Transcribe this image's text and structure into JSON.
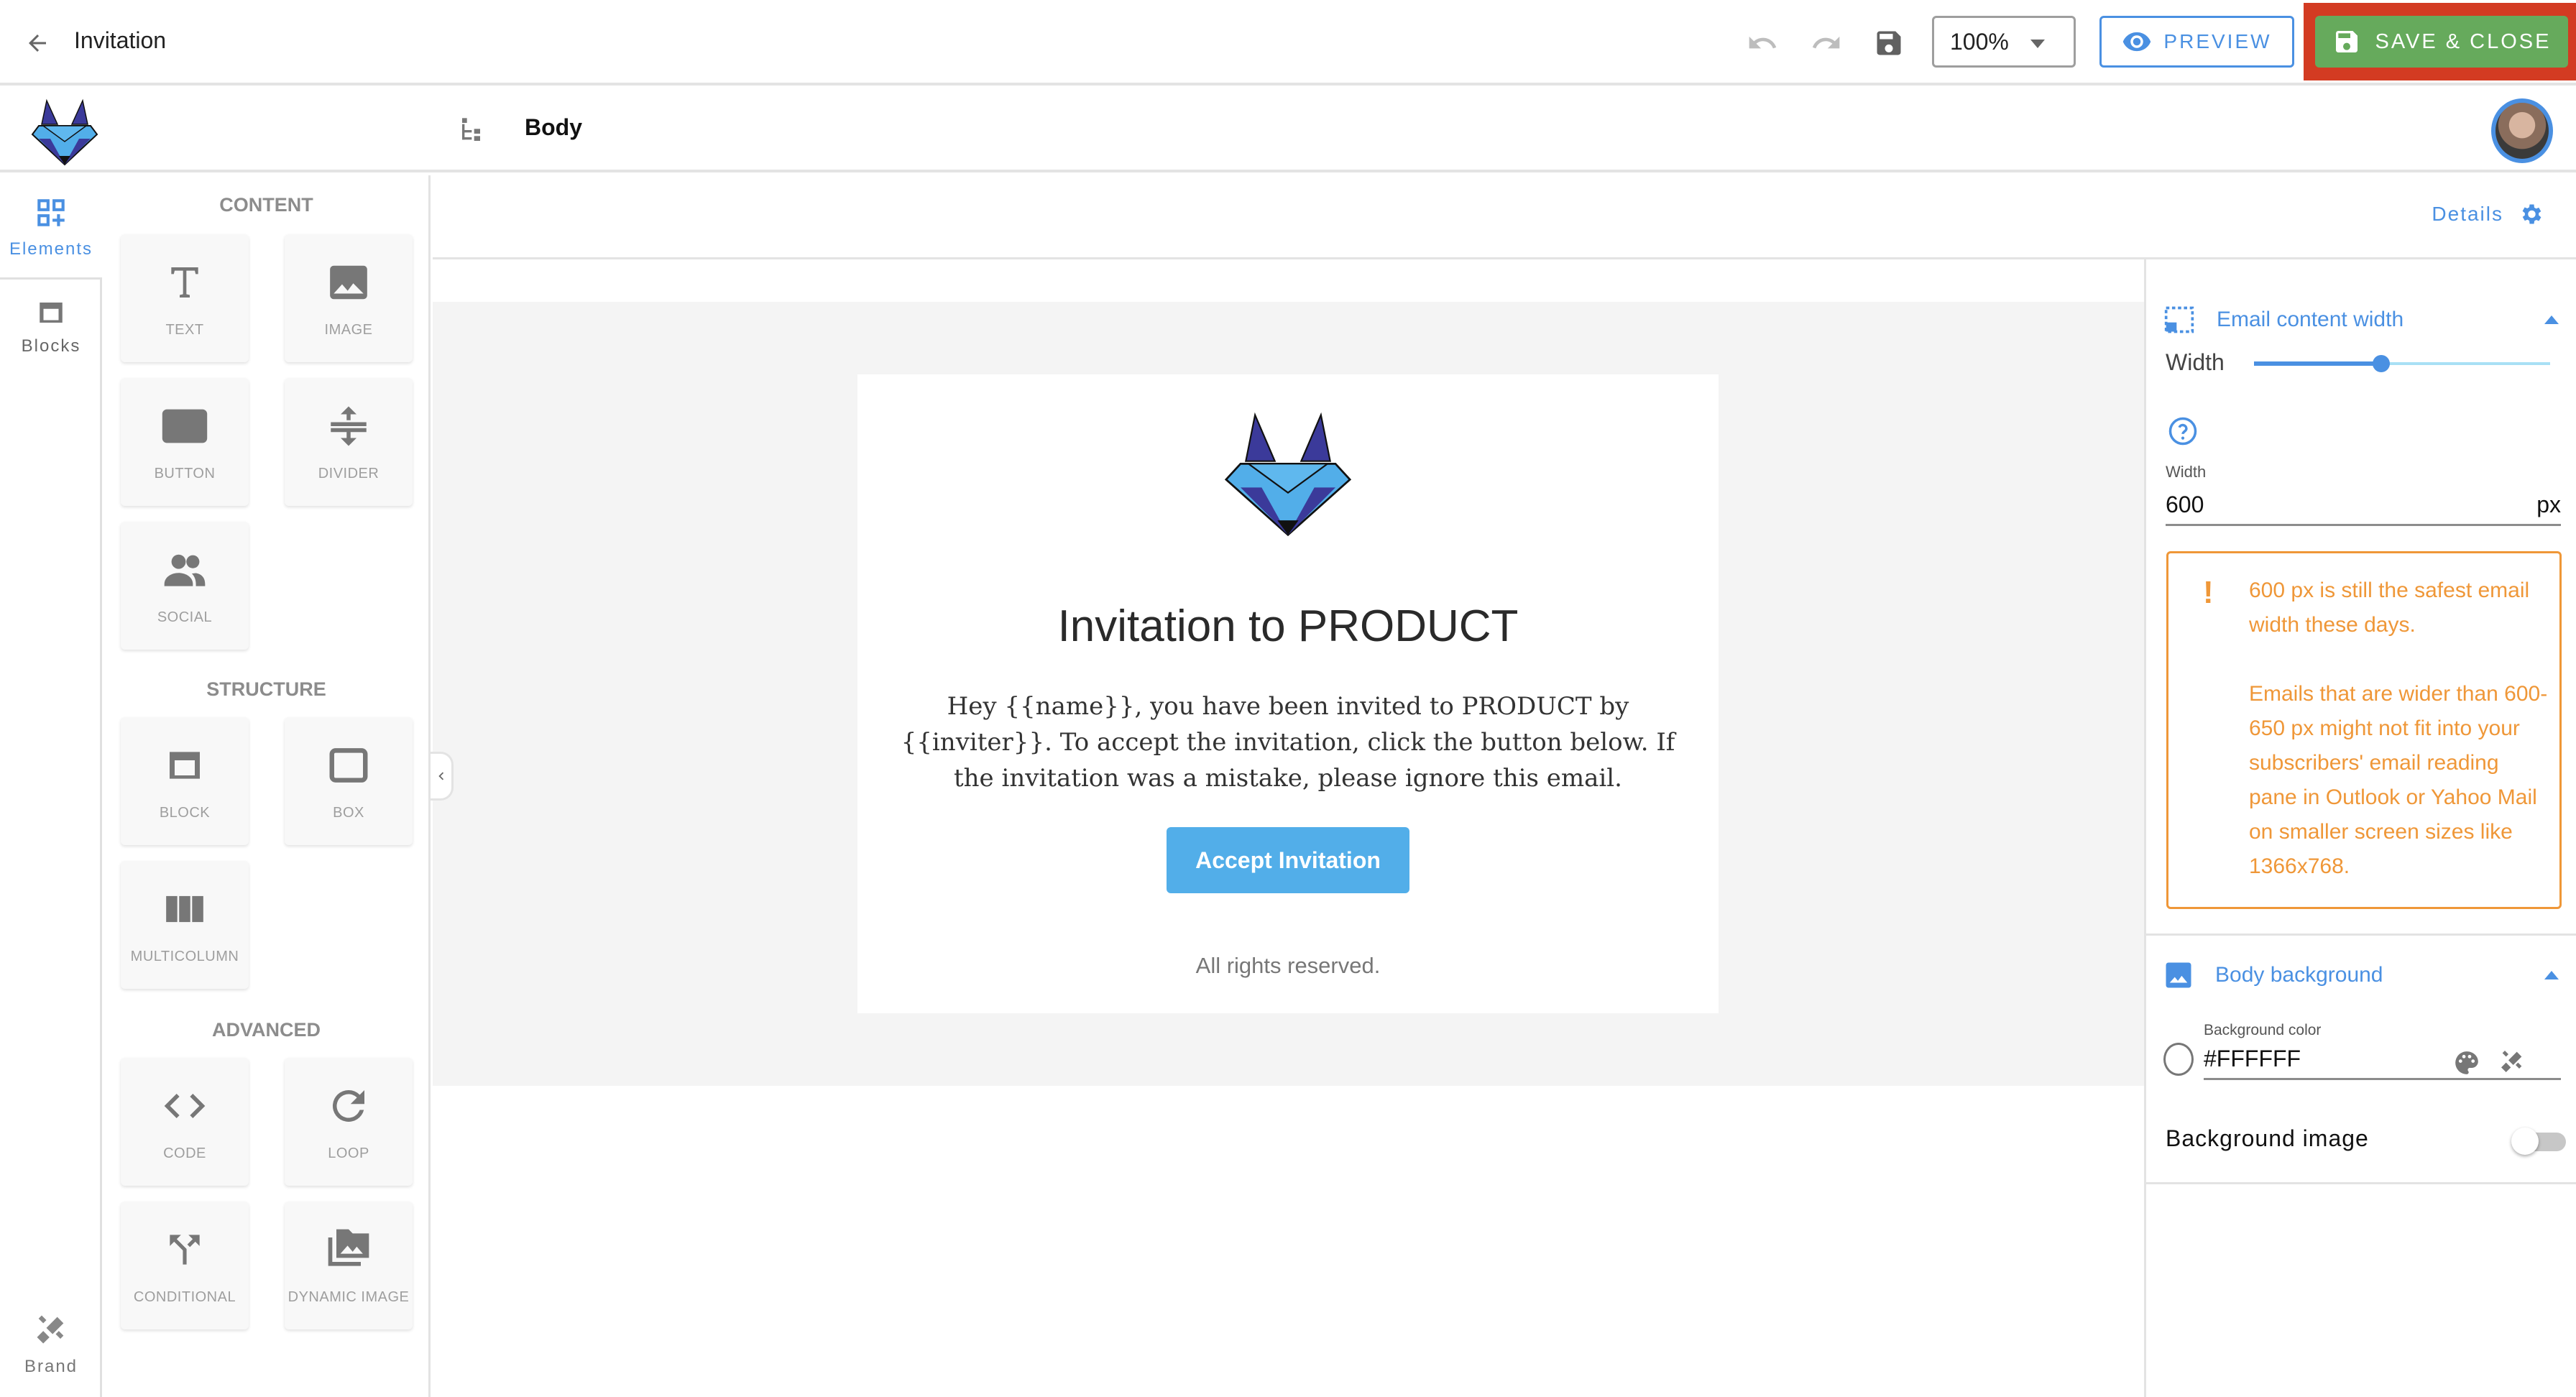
{
  "topbar": {
    "title": "Invitation",
    "zoom_value": "100%",
    "preview_label": "PREVIEW",
    "save_close_label": "SAVE & CLOSE",
    "icons": {
      "back": "arrow-left-icon",
      "undo": "undo-icon",
      "redo": "redo-icon",
      "save": "floppy-disk-icon",
      "preview": "eye-icon"
    }
  },
  "subbar": {
    "breadcrumb": "Body"
  },
  "rail": {
    "items": [
      {
        "label": "Elements",
        "icon": "add-elements-icon",
        "active": true
      },
      {
        "label": "Blocks",
        "icon": "block-icon",
        "active": false
      },
      {
        "label": "Brand",
        "icon": "design-tools-icon",
        "active": false
      }
    ]
  },
  "elements_panel": {
    "sections": [
      {
        "title": "CONTENT",
        "items": [
          "TEXT",
          "IMAGE",
          "BUTTON",
          "DIVIDER",
          "SOCIAL"
        ]
      },
      {
        "title": "STRUCTURE",
        "items": [
          "BLOCK",
          "BOX",
          "MULTICOLUMN"
        ]
      },
      {
        "title": "ADVANCED",
        "items": [
          "CODE",
          "LOOP",
          "CONDITIONAL",
          "DYNAMIC IMAGE"
        ]
      }
    ]
  },
  "details": {
    "label": "Details"
  },
  "email": {
    "heading": "Invitation to PRODUCT",
    "body": "Hey {{name}}, you have been invited to PRODUCT by {{inviter}}. To accept the invitation, click the button below. If the invitation was a mistake, please ignore this email.",
    "button_label": "Accept Invitation",
    "footer": "All rights reserved.",
    "button_color": "#52AEE9"
  },
  "right_panel": {
    "content_width": {
      "title": "Email content width",
      "slider_label": "Width",
      "slider_fraction": 0.43,
      "field_label": "Width",
      "field_value": "600",
      "unit": "px",
      "warning_line1": "600 px is still the safest email width these days.",
      "warning_line2": "Emails that are wider than 600-650 px might not fit into your subscribers' email reading pane in Outlook or Yahoo Mail on smaller screen sizes like 1366x768."
    },
    "body_background": {
      "title": "Body background",
      "color_label": "Background color",
      "color_value": "#FFFFFF",
      "image_label": "Background image",
      "image_enabled": false
    }
  },
  "colors": {
    "accent": "#4A90E2",
    "save_green": "#66AA5C",
    "highlight_red": "#D33B22",
    "warning_orange": "#EF9738"
  }
}
